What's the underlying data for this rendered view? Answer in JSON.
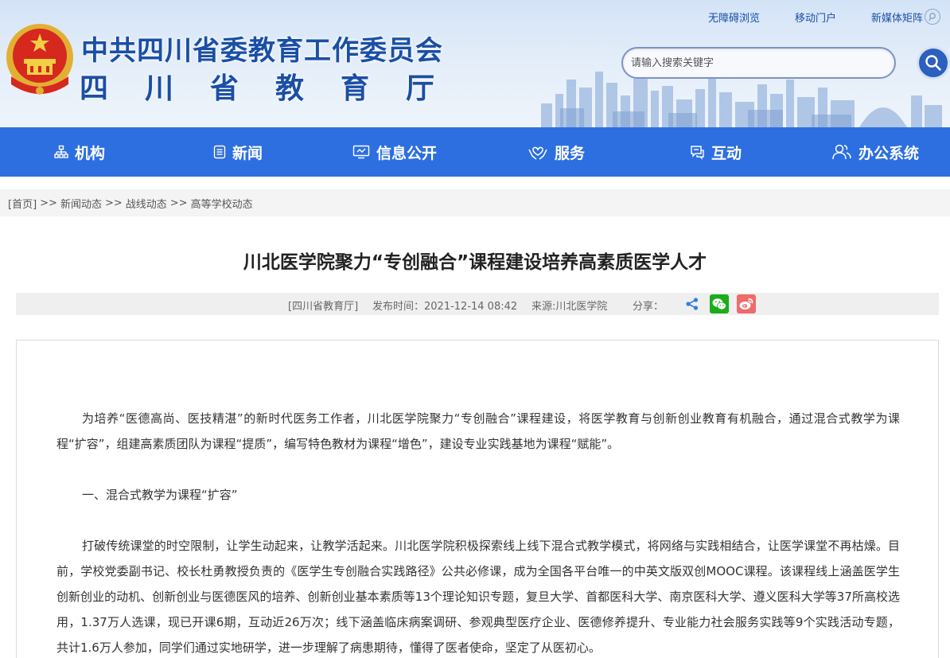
{
  "header": {
    "title_line1": "中共四川省委教育工作委员会",
    "title_line2": "四川省教育厅",
    "top_links": [
      "无障碍浏览",
      "移动门户",
      "新媒体矩阵"
    ],
    "search_placeholder": "请输入搜索关键字"
  },
  "nav": {
    "items": [
      {
        "label": "机构",
        "icon": "org-chart-icon"
      },
      {
        "label": "新闻",
        "icon": "document-icon"
      },
      {
        "label": "信息公开",
        "icon": "monitor-icon"
      },
      {
        "label": "服务",
        "icon": "hands-heart-icon"
      },
      {
        "label": "互动",
        "icon": "chat-bubble-icon"
      },
      {
        "label": "办公系统",
        "icon": "users-icon"
      }
    ]
  },
  "breadcrumb": {
    "items": [
      "[首页]",
      "新闻动态",
      "战线动态",
      "高等学校动态"
    ],
    "separator": ">>"
  },
  "article": {
    "title": "川北医学院聚力“专创融合”课程建设培养高素质医学人才",
    "meta_source": "[四川省教育厅]",
    "meta_date": "发布时间：2021-12-14 08:42",
    "meta_origin": "来源:川北医学院",
    "meta_share": "分享：",
    "share_icons": [
      "share-icon",
      "wechat-icon",
      "weibo-icon"
    ],
    "paragraphs": [
      "为培养“医德高尚、医技精湛”的新时代医务工作者，川北医学院聚力“专创融合”课程建设，将医学教育与创新创业教育有机融合，通过混合式教学为课程“扩容”，组建高素质团队为课程“提质”，编写特色教材为课程“增色”，建设专业实践基地为课程“赋能”。",
      "一、混合式教学为课程“扩容”",
      "打破传统课堂的时空限制，让学生动起来，让教学活起来。川北医学院积极探索线上线下混合式教学模式，将网络与实践相结合，让医学课堂不再枯燥。目前，学校党委副书记、校长杜勇教授负责的《医学生专创融合实践路径》公共必修课，成为全国各平台唯一的中英文版双创MOOC课程。该课程线上涵盖医学生创新创业的动机、创新创业与医德医风的培养、创新创业基本素质等13个理论知识专题，复旦大学、首都医科大学、南京医科大学、遵义医科大学等37所高校选用，1.37万人选课，现已开课6期，互动近26万次；线下涵盖临床病案调研、参观典型医疗企业、医德修养提升、专业能力社会服务实践等9个实践活动专题，共计1.6万人参加，同学们通过实地研学，进一步理解了病患期待，懂得了医者使命，坚定了从医初心。"
    ]
  },
  "colors": {
    "nav_bg": "#2d6fe0",
    "title_blue": "#1a4fa6",
    "wechat_green": "#1aad19",
    "weibo_red": "#f06a6a"
  }
}
